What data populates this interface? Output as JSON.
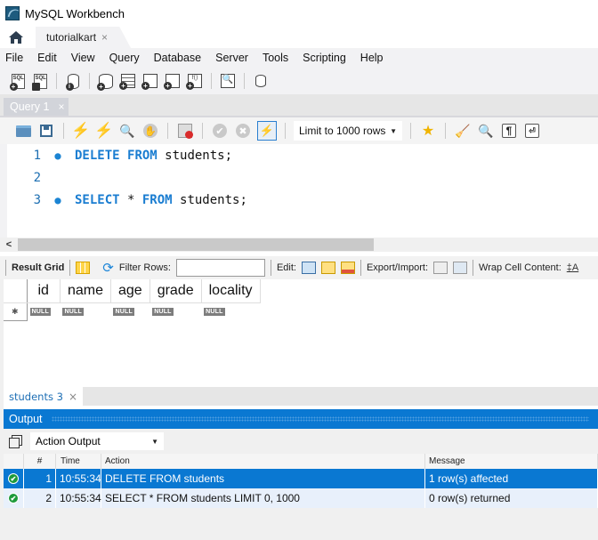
{
  "app": {
    "title": "MySQL Workbench"
  },
  "connection_tabs": [
    {
      "label": "tutorialkart",
      "close": "×"
    }
  ],
  "menu": [
    "File",
    "Edit",
    "View",
    "Query",
    "Database",
    "Server",
    "Tools",
    "Scripting",
    "Help"
  ],
  "main_toolbar": {
    "icons": [
      "new-sql-tab-icon",
      "open-sql-script-icon",
      "schema-inspector-icon",
      "create-schema-icon",
      "create-table-icon",
      "create-view-icon",
      "create-procedure-icon",
      "create-function-icon",
      "search-table-data-icon",
      "reconnect-icon"
    ]
  },
  "query_tabs": [
    {
      "label": "Query 1",
      "close": "×"
    }
  ],
  "query_toolbar": {
    "limit_select": "Limit to 1000 rows",
    "para_glyph": "¶"
  },
  "editor": {
    "lines": [
      {
        "num": "1",
        "marker": "●",
        "tokens": [
          {
            "t": "DELETE",
            "kw": true
          },
          {
            "t": " "
          },
          {
            "t": "FROM",
            "kw": true
          },
          {
            "t": " students;"
          }
        ]
      },
      {
        "num": "2",
        "marker": "",
        "tokens": []
      },
      {
        "num": "3",
        "marker": "●",
        "tokens": [
          {
            "t": "SELECT",
            "kw": true
          },
          {
            "t": " * "
          },
          {
            "t": "FROM",
            "kw": true
          },
          {
            "t": " students;"
          }
        ]
      }
    ]
  },
  "result_toolbar": {
    "result_grid": "Result Grid",
    "filter_rows": "Filter Rows:",
    "filter_value": "",
    "edit": "Edit:",
    "export_import": "Export/Import:",
    "wrap_cell": "Wrap Cell Content:"
  },
  "result_grid": {
    "columns": [
      "id",
      "name",
      "age",
      "grade",
      "locality"
    ],
    "new_row": [
      "NULL",
      "NULL",
      "NULL",
      "NULL",
      "NULL"
    ],
    "new_row_marker": "✱"
  },
  "result_tabs": [
    {
      "label": "students 3",
      "close": "×"
    }
  ],
  "output": {
    "title": "Output",
    "mode": "Action Output",
    "headers": {
      "num": "#",
      "time": "Time",
      "action": "Action",
      "message": "Message"
    },
    "rows": [
      {
        "num": "1",
        "time": "10:55:34",
        "action": "DELETE FROM students",
        "message": "1 row(s) affected",
        "status": "success",
        "selected": true
      },
      {
        "num": "2",
        "time": "10:55:34",
        "action": "SELECT * FROM students LIMIT 0, 1000",
        "message": "0 row(s) returned",
        "status": "success",
        "selected": false
      }
    ]
  },
  "colors": {
    "accent": "#0a78d2",
    "keyword": "#1a7dd1",
    "success": "#1e9a3a"
  }
}
